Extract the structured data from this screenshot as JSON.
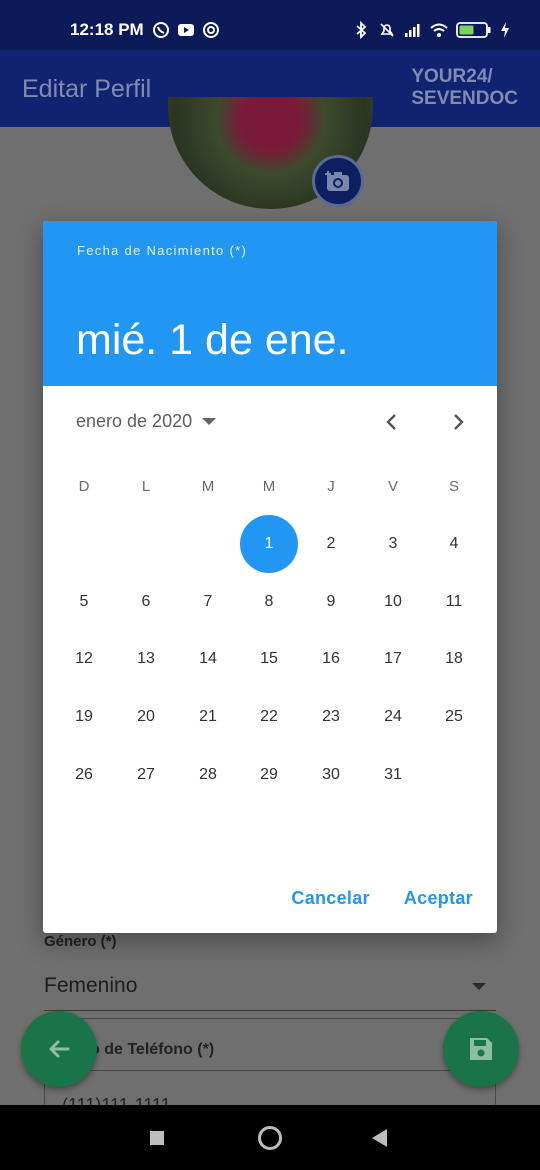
{
  "status_bar": {
    "time": "12:18 PM",
    "left_icons": [
      "whatsapp-icon",
      "youtube-icon",
      "app-icon"
    ],
    "right_icons": [
      "bluetooth-icon",
      "mute-icon",
      "signal-icon",
      "wifi-icon",
      "battery-icon",
      "charging-icon"
    ],
    "battery": "47"
  },
  "app_bar": {
    "title": "Editar Perfil",
    "logo_line1": "YOUR24/",
    "logo_line2": "SEVENDOC"
  },
  "background_form": {
    "gender_label": "Género (*)",
    "gender_value": "Femenino",
    "phone_label": "o de Teléfono (*)",
    "phone_value": "(111)111-1111"
  },
  "date_picker": {
    "help_text": "Fecha de Nacimiento (*)",
    "selected_date": "mié. 1 de ene.",
    "month_year": "enero de 2020",
    "weekdays": [
      "D",
      "L",
      "M",
      "M",
      "J",
      "V",
      "S"
    ],
    "days": [
      "1",
      "2",
      "3",
      "4",
      "5",
      "6",
      "7",
      "8",
      "9",
      "10",
      "11",
      "12",
      "13",
      "14",
      "15",
      "16",
      "17",
      "18",
      "19",
      "20",
      "21",
      "22",
      "23",
      "24",
      "25",
      "26",
      "27",
      "28",
      "29",
      "30",
      "31"
    ],
    "selected_day": "1",
    "cancel_label": "Cancelar",
    "ok_label": "Aceptar"
  },
  "colors": {
    "accent": "#2196f3",
    "app_bar": "#112370",
    "status_bar": "#0d1a5a",
    "fab": "#19744a"
  }
}
